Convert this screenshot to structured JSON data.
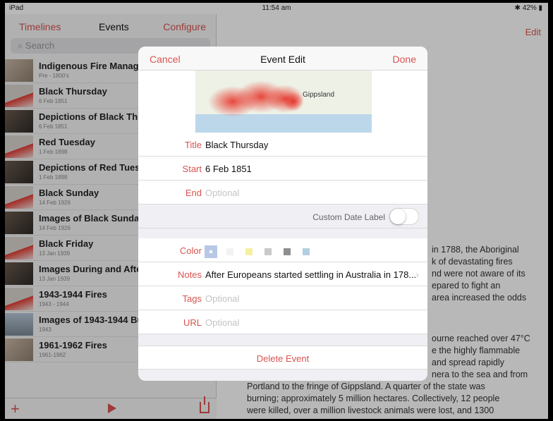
{
  "status_bar": {
    "device": "iPad",
    "time": "11:54 am",
    "battery": "42%"
  },
  "left_panel": {
    "nav": {
      "timelines": "Timelines",
      "events": "Events",
      "configure": "Configure"
    },
    "search_placeholder": "Search",
    "items": [
      {
        "title": "Indigenous Fire Manage",
        "date": "Pre - 1800's",
        "thumb": "land"
      },
      {
        "title": "Black Thursday",
        "date": "6 Feb 1851",
        "thumb": "red"
      },
      {
        "title": "Depictions of Black Thu",
        "date": "6 Feb 1851",
        "thumb": "dark"
      },
      {
        "title": "Red Tuesday",
        "date": "1 Feb 1898",
        "thumb": "red"
      },
      {
        "title": "Depictions of Red Tuesc",
        "date": "1 Feb 1898",
        "thumb": "dark"
      },
      {
        "title": "Black Sunday",
        "date": "14 Feb 1926",
        "thumb": "red"
      },
      {
        "title": "Images of Black Sunday",
        "date": "14 Feb 1926",
        "thumb": "dark"
      },
      {
        "title": "Black Friday",
        "date": "13 Jan 1939",
        "thumb": "red"
      },
      {
        "title": "Images During and Afte",
        "date": "13 Jan 1939",
        "thumb": "dark"
      },
      {
        "title": "1943-1944 Fires",
        "date": "1943 - 1944",
        "thumb": "red"
      },
      {
        "title": "Images of 1943-1944 Bu",
        "date": "1943",
        "thumb": "sky"
      },
      {
        "title": "1961-1962 Fires",
        "date": "1961-1962",
        "thumb": "land"
      }
    ],
    "toolbar": {
      "add_icon": "plus-icon",
      "play_icon": "play-icon",
      "share_icon": "share-icon"
    }
  },
  "right_panel": {
    "edit": "Edit",
    "text_lines_top": [
      "in 1788, the Aboriginal",
      "k of devastating fires",
      "nd were not aware of its",
      "epared to fight an",
      "area increased the odds"
    ],
    "text_lines_bottom": [
      "ourne reached over 47°C",
      "e the highly flammable",
      "and spread rapidly",
      "nera to the sea and from"
    ],
    "text_full_lines": [
      "Portland to the fringe of Gippsland. A quarter of the state was",
      "burning; approximately 5 million hectares. Collectively, 12 people",
      "were killed, over a million livestock animals were lost, and 1300"
    ]
  },
  "modal": {
    "cancel": "Cancel",
    "title": "Event Edit",
    "done": "Done",
    "map_label": "Gippsland",
    "fields": {
      "title_label": "Title",
      "title_value": "Black Thursday",
      "start_label": "Start",
      "start_value": "6 Feb 1851",
      "end_label": "End",
      "end_placeholder": "Optional",
      "custom_date_label": "Custom Date Label",
      "color_label": "Color",
      "notes_label": "Notes",
      "notes_value": "After Europeans started settling in Australia in 178...",
      "tags_label": "Tags",
      "tags_placeholder": "Optional",
      "url_label": "URL",
      "url_placeholder": "Optional"
    },
    "swatches": [
      "#b7c8e6",
      "#f2f2f2",
      "#f5f0a0",
      "#c9c9c9",
      "#8f8f8f",
      "#b2cfe0"
    ],
    "custom_date_toggle": false,
    "delete": "Delete Event"
  }
}
